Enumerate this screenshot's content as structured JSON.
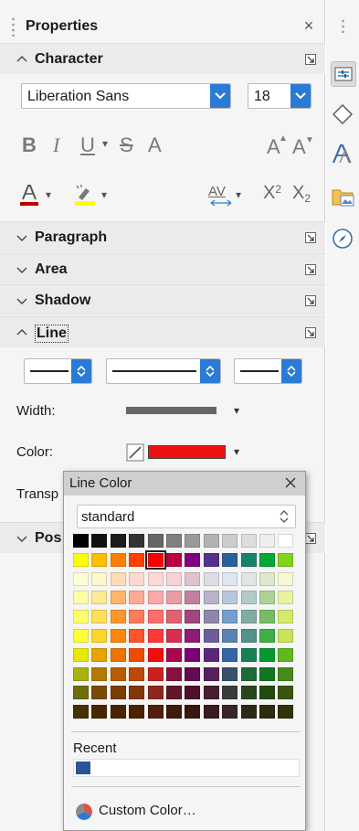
{
  "panel": {
    "title": "Properties",
    "close_glyph": "×"
  },
  "sections": {
    "character": "Character",
    "paragraph": "Paragraph",
    "area": "Area",
    "shadow": "Shadow",
    "line": "Line",
    "position_partial": "Pos"
  },
  "character": {
    "font_name": "Liberation Sans",
    "font_size": "18",
    "bold": "B",
    "italic": "I",
    "underline": "U",
    "strike": "S",
    "shadow": "A",
    "grow": "A",
    "shrink": "A",
    "spacing": "AV",
    "superscript_base": "X",
    "superscript_exp": "2",
    "subscript_base": "X",
    "subscript_exp": "2",
    "font_color": "#c00000",
    "highlight_color": "#ffff00"
  },
  "line": {
    "width_label": "Width:",
    "color_label": "Color:",
    "transparency_partial": "Transp",
    "color_value": "#ee1111"
  },
  "popup": {
    "title": "Line Color",
    "palette": "standard",
    "recent_label": "Recent",
    "recent_color": "#2a5699",
    "custom_label": "Custom Color…",
    "selected": [
      1,
      4
    ],
    "rows": [
      [
        "#000000",
        "#111111",
        "#1c1c1c",
        "#333333",
        "#666666",
        "#808080",
        "#999999",
        "#b2b2b2",
        "#cccccc",
        "#dddddd",
        "#eeeeee",
        "#ffffff"
      ],
      [
        "#ffff00",
        "#ffbf00",
        "#ff8000",
        "#ff4000",
        "#ff0000",
        "#bf0041",
        "#800080",
        "#55308d",
        "#2a6099",
        "#158466",
        "#00a933",
        "#81d41a"
      ],
      [
        "#ffffd7",
        "#fff5ce",
        "#ffdbb6",
        "#ffd8ce",
        "#ffd7d7",
        "#f7d1d5",
        "#e0c2cd",
        "#dedce6",
        "#dee6ef",
        "#dee7e5",
        "#dde8cb",
        "#f6f9d4"
      ],
      [
        "#ffffa6",
        "#ffe994",
        "#ffb66c",
        "#ffaa95",
        "#ffa6a6",
        "#ec9ba4",
        "#bf819e",
        "#b7b3ca",
        "#b4c7dc",
        "#b3cac7",
        "#afd095",
        "#e8f2a1"
      ],
      [
        "#ffff6d",
        "#ffde59",
        "#ff972f",
        "#ff7b59",
        "#ff6d6d",
        "#e16173",
        "#a1467e",
        "#8e86ae",
        "#729fcf",
        "#81aca6",
        "#77bc65",
        "#d4ea6b"
      ],
      [
        "#ffff38",
        "#ffd428",
        "#ff860d",
        "#ff5429",
        "#ff3838",
        "#d62e4e",
        "#8d1d75",
        "#6b5e9b",
        "#5983b0",
        "#50938a",
        "#3faf46",
        "#c9e359"
      ],
      [
        "#e6e905",
        "#e8a202",
        "#ea7500",
        "#ed4c05",
        "#f10d0c",
        "#a7074b",
        "#780373",
        "#5b277d",
        "#3465a4",
        "#168253",
        "#069a2e",
        "#5eb91e"
      ],
      [
        "#acb20c",
        "#b47804",
        "#b85c00",
        "#be480a",
        "#c9211e",
        "#861141",
        "#650953",
        "#55215b",
        "#355269",
        "#1e6a39",
        "#127622",
        "#468a1a"
      ],
      [
        "#706e0c",
        "#784b04",
        "#7b3d00",
        "#813709",
        "#8d281e",
        "#611729",
        "#4e102d",
        "#481d32",
        "#383d3c",
        "#28471f",
        "#224b12",
        "#395511"
      ],
      [
        "#443205",
        "#472702",
        "#492300",
        "#4b2204",
        "#50200c",
        "#41190d",
        "#3b160e",
        "#3a1a1e",
        "#372624",
        "#2b2a17",
        "#2b2d0e",
        "#313208"
      ]
    ]
  }
}
